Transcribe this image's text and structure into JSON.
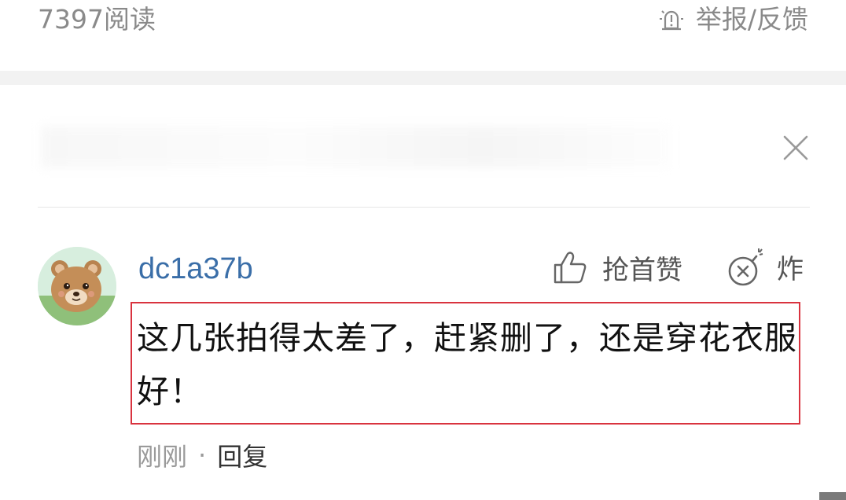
{
  "header": {
    "read_count": "7397阅读",
    "report_label": "举报/反馈",
    "report_icon": "report-icon"
  },
  "panel": {
    "close_icon": "close-icon"
  },
  "comment": {
    "avatar_icon": "bear-avatar",
    "username": "dc1a37b",
    "like_label": "抢首赞",
    "like_icon": "thumbs-up-icon",
    "bomb_label": "炸",
    "bomb_icon": "bomb-icon",
    "text": "这几张拍得太差了，赶紧删了，还是穿花衣服好！",
    "time": "刚刚",
    "separator": "·",
    "reply_label": "回复"
  },
  "colors": {
    "username": "#3a6ea8",
    "highlight_border": "#d9333f",
    "muted": "#9a9a9a",
    "band": "#f2f2f2"
  }
}
